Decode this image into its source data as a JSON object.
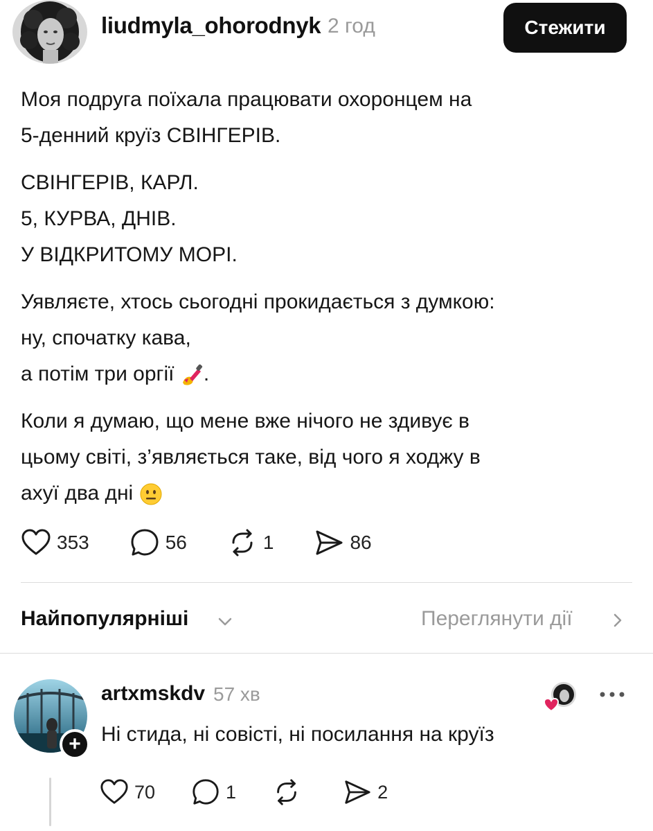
{
  "post": {
    "username": "liudmyla_ohorodnyk",
    "time": "2 год",
    "follow_label": "Стежити",
    "paragraphs": [
      [
        "Моя подруга поїхала працювати охоронцем на",
        "5-денний круїз СВІНГЕРІВ."
      ],
      [
        "СВІНГЕРІВ, КАРЛ.",
        "5, КУРВА, ДНІВ.",
        "У ВІДКРИТОМУ МОРІ."
      ],
      [
        "Уявляєте, хтось сьогодні прокидається з думкою:",
        "ну, спочатку кава,",
        "а потім три оргії"
      ],
      [
        "Коли я думаю, що мене вже нічого не здивує в",
        "цьому світі, з’являється таке, від чого я ходжу в",
        "ахуї два дні"
      ]
    ],
    "after_nail_emoji": ".",
    "emojis": {
      "nail_polish": "nail-polish-emoji",
      "neutral_face": "neutral-face-emoji"
    },
    "stats": {
      "likes": "353",
      "comments": "56",
      "reposts": "1",
      "shares": "86"
    }
  },
  "sort": {
    "label": "Найпопулярніші",
    "view_activity": "Переглянути дії"
  },
  "comment": {
    "username": "artxmskdv",
    "time": "57 хв",
    "text": "Ні стида, ні совісті, ні посилання на круїз",
    "add_symbol": "+",
    "stats": {
      "likes": "70",
      "comments": "1",
      "shares": "2"
    }
  },
  "colors": {
    "accent": "#101010",
    "muted": "#9a9a9a",
    "heart": "#e0245e"
  }
}
